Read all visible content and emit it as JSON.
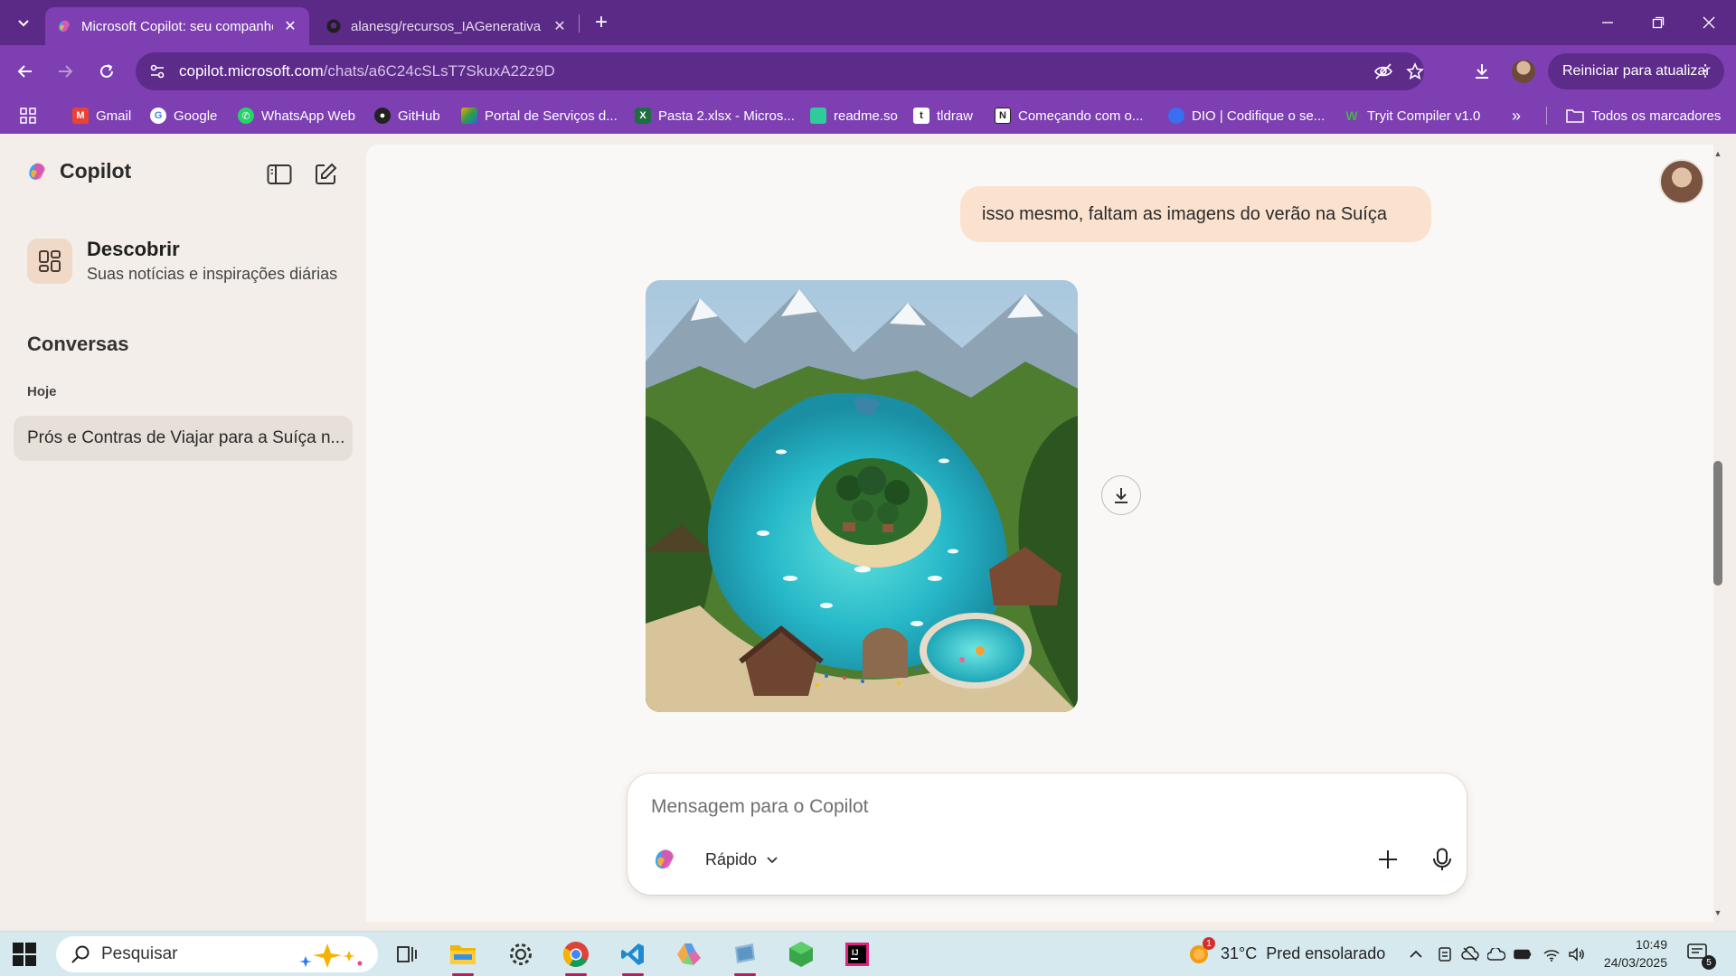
{
  "browser": {
    "tabs": [
      {
        "title": "Microsoft Copilot: seu companheiro de IA",
        "active": true
      },
      {
        "title": "alanesg/recursos_IAGenerativa",
        "active": false
      }
    ],
    "url_host": "copilot.microsoft.com",
    "url_path": "/chats/a6C24cSLsT7SkuxA22z9D",
    "update_button": "Reiniciar para atualizar",
    "bookmarks": [
      {
        "label": "Gmail",
        "color": "#ea4335",
        "glyph": "M"
      },
      {
        "label": "Google",
        "color": "#ffffff",
        "glyph": "G"
      },
      {
        "label": "WhatsApp Web",
        "color": "#25d366",
        "glyph": "✆"
      },
      {
        "label": "GitHub",
        "color": "#222222",
        "glyph": "●"
      },
      {
        "label": "Portal de Serviços d...",
        "color": "#f4a300",
        "glyph": "◆"
      },
      {
        "label": "Pasta 2.xlsx - Micros...",
        "color": "#1d6f42",
        "glyph": "X"
      },
      {
        "label": "readme.so",
        "color": "#2ecc9a",
        "glyph": "■"
      },
      {
        "label": "tldraw",
        "color": "#ffffff",
        "glyph": "t"
      },
      {
        "label": "Começando com o...",
        "color": "#ffffff",
        "glyph": "N"
      },
      {
        "label": "DIO | Codifique o se...",
        "color": "#3a6df0",
        "glyph": "●"
      },
      {
        "label": "Tryit Compiler v1.0",
        "color": "#4caf50",
        "glyph": "W"
      }
    ],
    "all_bookmarks": "Todos os marcadores"
  },
  "sidebar": {
    "brand": "Copilot",
    "discover_title": "Descobrir",
    "discover_subtitle": "Suas notícias e inspirações diárias",
    "section_title": "Conversas",
    "today_label": "Hoje",
    "conversations": [
      "Prós e Contras de Viajar para a Suíça n..."
    ]
  },
  "chat": {
    "user_message": "isso mesmo, faltam as imagens do verão na Suíça"
  },
  "composer": {
    "placeholder": "Mensagem para o Copilot",
    "mode": "Rápido"
  },
  "taskbar": {
    "search_placeholder": "Pesquisar",
    "temperature": "31°C",
    "weather_text": "Pred ensolarado",
    "weather_badge": "1",
    "time": "10:49",
    "date": "24/03/2025",
    "notifications": "5"
  },
  "colors": {
    "tab_bar": "#5b2a86",
    "toolbar": "#7d3fb2",
    "user_bubble": "#fbe2cf",
    "page_bg": "#f3eee9"
  }
}
